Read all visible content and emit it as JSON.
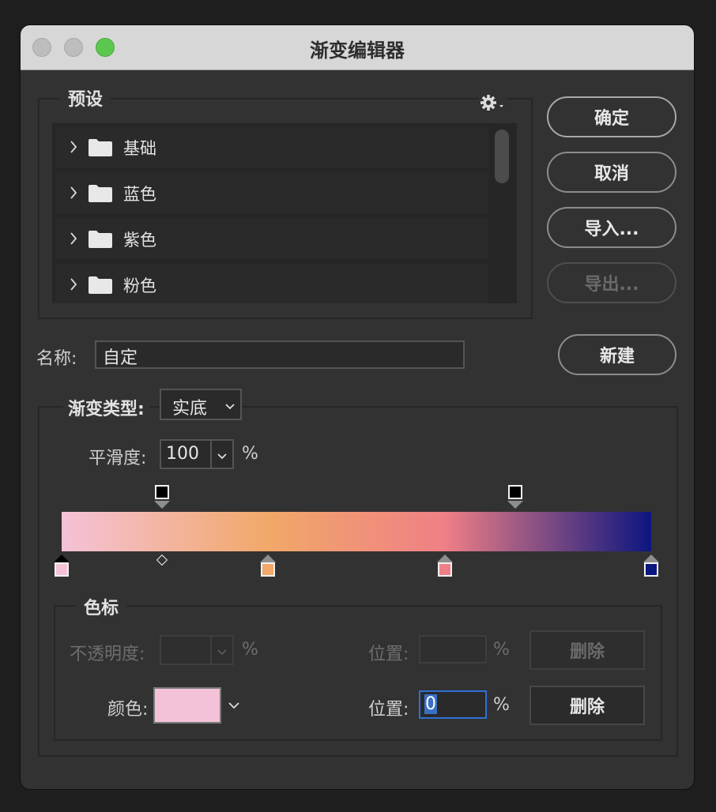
{
  "window": {
    "title": "渐变编辑器"
  },
  "presets": {
    "label": "预设",
    "items": [
      {
        "label": "基础"
      },
      {
        "label": "蓝色"
      },
      {
        "label": "紫色"
      },
      {
        "label": "粉色"
      }
    ]
  },
  "buttons": {
    "ok": "确定",
    "cancel": "取消",
    "import": "导入...",
    "export": "导出...",
    "new": "新建"
  },
  "name": {
    "label": "名称:",
    "value": "自定"
  },
  "gradient_type": {
    "label": "渐变类型:",
    "value": "实底"
  },
  "smoothness": {
    "label": "平滑度:",
    "value": "100",
    "unit": "%"
  },
  "gradient": {
    "color_stops": [
      {
        "position": 0,
        "color": "#f4c2d8"
      },
      {
        "position": 35,
        "color": "#f1a868"
      },
      {
        "position": 65,
        "color": "#ef7f86"
      },
      {
        "position": 100,
        "color": "#0c1680"
      }
    ],
    "midpoints": [
      17
    ],
    "opacity_stops": [
      17,
      77
    ]
  },
  "stops": {
    "label": "色标",
    "opacity_label": "不透明度:",
    "opacity_unit": "%",
    "opacity_position_label": "位置:",
    "opacity_position_unit": "%",
    "opacity_delete": "删除",
    "color_label": "颜色:",
    "color_value": "#f4c2d8",
    "color_position_label": "位置:",
    "color_position_value": "0",
    "color_position_unit": "%",
    "color_delete": "删除"
  }
}
